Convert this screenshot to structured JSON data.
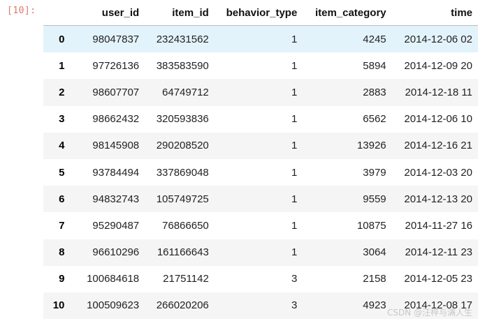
{
  "cell": {
    "prompt": "[10]:"
  },
  "table": {
    "columns": [
      "",
      "user_id",
      "item_id",
      "behavior_type",
      "item_category",
      "time"
    ],
    "rows": [
      {
        "index": "0",
        "user_id": "98047837",
        "item_id": "232431562",
        "behavior_type": "1",
        "item_category": "4245",
        "time": "2014-12-06 02"
      },
      {
        "index": "1",
        "user_id": "97726136",
        "item_id": "383583590",
        "behavior_type": "1",
        "item_category": "5894",
        "time": "2014-12-09 20"
      },
      {
        "index": "2",
        "user_id": "98607707",
        "item_id": "64749712",
        "behavior_type": "1",
        "item_category": "2883",
        "time": "2014-12-18 11"
      },
      {
        "index": "3",
        "user_id": "98662432",
        "item_id": "320593836",
        "behavior_type": "1",
        "item_category": "6562",
        "time": "2014-12-06 10"
      },
      {
        "index": "4",
        "user_id": "98145908",
        "item_id": "290208520",
        "behavior_type": "1",
        "item_category": "13926",
        "time": "2014-12-16 21"
      },
      {
        "index": "5",
        "user_id": "93784494",
        "item_id": "337869048",
        "behavior_type": "1",
        "item_category": "3979",
        "time": "2014-12-03 20"
      },
      {
        "index": "6",
        "user_id": "94832743",
        "item_id": "105749725",
        "behavior_type": "1",
        "item_category": "9559",
        "time": "2014-12-13 20"
      },
      {
        "index": "7",
        "user_id": "95290487",
        "item_id": "76866650",
        "behavior_type": "1",
        "item_category": "10875",
        "time": "2014-11-27 16"
      },
      {
        "index": "8",
        "user_id": "96610296",
        "item_id": "161166643",
        "behavior_type": "1",
        "item_category": "3064",
        "time": "2014-12-11 23"
      },
      {
        "index": "9",
        "user_id": "100684618",
        "item_id": "21751142",
        "behavior_type": "3",
        "item_category": "2158",
        "time": "2014-12-05 23"
      },
      {
        "index": "10",
        "user_id": "100509623",
        "item_id": "266020206",
        "behavior_type": "3",
        "item_category": "4923",
        "time": "2014-12-08 17"
      }
    ]
  },
  "watermark": "CSDN @汪梓与满人生"
}
